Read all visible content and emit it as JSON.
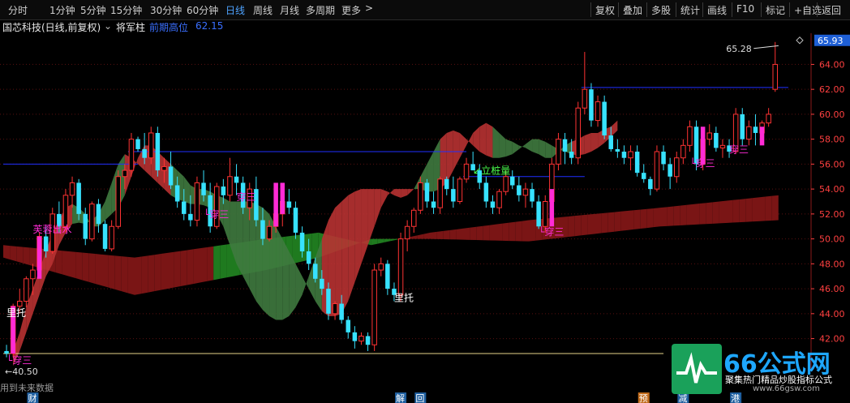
{
  "toolbar": {
    "periods": [
      "分时",
      "1分钟",
      "5分钟",
      "15分钟",
      "30分钟",
      "60分钟",
      "日线",
      "周线",
      "月线",
      "多周期",
      "更多"
    ],
    "active_period": "日线",
    "more_chevron": ">",
    "right_buttons": [
      "复权",
      "叠加",
      "多股",
      "统计",
      "画线",
      "F10",
      "标记",
      "+自选",
      "返回"
    ]
  },
  "info": {
    "stock": "国芯科技(日线,前复权)",
    "indicator": "将军柱",
    "label": "前期高位",
    "value": "62.15"
  },
  "colors": {
    "up": "#ff3333",
    "down": "#37e2ff",
    "magenta": "#ff2bd6",
    "band_red": "#b83232",
    "band_green": "#3f7a3f",
    "long_red": "#7a1515",
    "long_green": "#1f7a1f",
    "hline_blue": "#1f2fff",
    "axis_text": "#ff4040",
    "accent": "#4ea3ff"
  },
  "chart_data": {
    "type": "candlestick",
    "ylim": [
      39.5,
      66.5
    ],
    "y_ticks": [
      42.0,
      44.0,
      46.0,
      48.0,
      50.0,
      52.0,
      54.0,
      56.0,
      58.0,
      60.0,
      62.0,
      64.0
    ],
    "current_price": "65.93",
    "candles": [
      [
        41.0,
        41.5,
        40.5,
        40.8
      ],
      [
        40.8,
        44.8,
        40.5,
        44.6
      ],
      [
        44.6,
        46.0,
        44.0,
        45.0
      ],
      [
        45.0,
        47.0,
        44.5,
        46.8
      ],
      [
        46.8,
        48.0,
        45.5,
        47.5
      ],
      [
        47.5,
        50.5,
        47.0,
        50.2
      ],
      [
        50.2,
        51.0,
        48.5,
        49.0
      ],
      [
        49.0,
        52.5,
        48.8,
        52.0
      ],
      [
        52.0,
        53.0,
        50.5,
        51.0
      ],
      [
        51.0,
        54.0,
        50.5,
        53.5
      ],
      [
        53.5,
        55.0,
        52.5,
        54.5
      ],
      [
        54.5,
        54.8,
        51.5,
        52.0
      ],
      [
        52.0,
        52.5,
        49.5,
        50.0
      ],
      [
        50.0,
        53.0,
        49.8,
        52.8
      ],
      [
        52.8,
        53.2,
        50.5,
        51.2
      ],
      [
        51.2,
        51.5,
        49.0,
        49.2
      ],
      [
        49.2,
        51.5,
        49.0,
        51.0
      ],
      [
        51.0,
        55.5,
        50.8,
        55.0
      ],
      [
        55.0,
        56.0,
        54.0,
        55.5
      ],
      [
        55.5,
        58.5,
        55.0,
        58.0
      ],
      [
        58.0,
        58.2,
        57.0,
        57.2
      ],
      [
        57.2,
        58.5,
        56.0,
        56.5
      ],
      [
        56.5,
        59.0,
        56.0,
        58.5
      ],
      [
        58.5,
        59.0,
        55.0,
        55.5
      ],
      [
        55.5,
        56.5,
        54.5,
        55.8
      ],
      [
        55.8,
        57.0,
        54.0,
        54.3
      ],
      [
        54.3,
        55.0,
        52.5,
        53.0
      ],
      [
        53.0,
        54.0,
        51.5,
        52.0
      ],
      [
        52.0,
        53.5,
        51.0,
        51.5
      ],
      [
        51.5,
        55.0,
        51.0,
        54.5
      ],
      [
        54.5,
        55.5,
        53.0,
        53.5
      ],
      [
        53.5,
        54.5,
        50.5,
        51.0
      ],
      [
        51.0,
        54.5,
        50.8,
        54.2
      ],
      [
        54.2,
        54.8,
        52.8,
        53.5
      ],
      [
        53.5,
        56.5,
        53.0,
        55.0
      ],
      [
        55.0,
        56.0,
        53.5,
        54.5
      ],
      [
        54.5,
        55.0,
        52.0,
        52.5
      ],
      [
        52.5,
        54.5,
        51.5,
        54.0
      ],
      [
        54.0,
        55.0,
        51.0,
        51.5
      ],
      [
        51.5,
        52.5,
        49.5,
        50.0
      ],
      [
        50.0,
        51.5,
        49.8,
        51.0
      ],
      [
        51.0,
        52.5,
        50.5,
        52.0
      ],
      [
        52.0,
        53.5,
        51.0,
        53.0
      ],
      [
        53.0,
        54.0,
        52.0,
        52.5
      ],
      [
        52.5,
        53.0,
        50.0,
        50.5
      ],
      [
        50.5,
        51.0,
        48.5,
        49.0
      ],
      [
        49.0,
        50.0,
        47.5,
        48.0
      ],
      [
        48.0,
        48.5,
        46.5,
        46.8
      ],
      [
        46.8,
        47.5,
        45.5,
        46.0
      ],
      [
        46.0,
        46.5,
        43.5,
        44.0
      ],
      [
        44.0,
        45.0,
        43.5,
        44.8
      ],
      [
        44.8,
        45.5,
        43.2,
        43.5
      ],
      [
        43.5,
        43.8,
        42.0,
        42.5
      ],
      [
        42.5,
        43.0,
        41.2,
        41.8
      ],
      [
        41.8,
        42.5,
        41.5,
        42.2
      ],
      [
        42.2,
        42.5,
        41.0,
        41.5
      ],
      [
        41.5,
        48.0,
        41.0,
        47.5
      ],
      [
        47.5,
        48.5,
        47.0,
        48.0
      ],
      [
        48.0,
        48.3,
        45.5,
        46.0
      ],
      [
        46.0,
        46.5,
        45.0,
        45.5
      ],
      [
        45.5,
        50.5,
        45.0,
        50.0
      ],
      [
        50.0,
        51.5,
        49.0,
        51.0
      ],
      [
        51.0,
        52.5,
        50.5,
        52.3
      ],
      [
        52.3,
        55.0,
        52.0,
        54.5
      ],
      [
        54.5,
        54.8,
        52.5,
        53.0
      ],
      [
        53.0,
        53.8,
        52.0,
        52.5
      ],
      [
        52.5,
        55.0,
        52.0,
        54.8
      ],
      [
        54.8,
        55.0,
        53.5,
        54.0
      ],
      [
        54.0,
        55.0,
        52.5,
        53.0
      ],
      [
        53.0,
        55.0,
        52.8,
        54.8
      ],
      [
        54.8,
        56.5,
        54.5,
        56.0
      ],
      [
        56.0,
        57.0,
        55.5,
        55.5
      ],
      [
        55.5,
        56.0,
        54.0,
        54.5
      ],
      [
        54.5,
        55.0,
        52.5,
        53.0
      ],
      [
        53.0,
        53.5,
        52.0,
        52.5
      ],
      [
        52.5,
        54.0,
        52.0,
        53.8
      ],
      [
        53.8,
        55.5,
        53.5,
        55.0
      ],
      [
        55.0,
        55.5,
        54.0,
        54.3
      ],
      [
        54.3,
        55.0,
        53.0,
        53.5
      ],
      [
        53.5,
        54.5,
        52.5,
        54.0
      ],
      [
        54.0,
        54.5,
        52.5,
        53.0
      ],
      [
        53.0,
        53.5,
        50.8,
        51.0
      ],
      [
        51.0,
        53.5,
        50.5,
        53.0
      ],
      [
        53.0,
        56.5,
        52.5,
        56.0
      ],
      [
        56.0,
        58.5,
        55.5,
        58.0
      ],
      [
        58.0,
        58.5,
        56.0,
        57.0
      ],
      [
        57.0,
        58.0,
        56.0,
        56.5
      ],
      [
        56.5,
        61.0,
        56.0,
        60.5
      ],
      [
        60.5,
        65.0,
        60.0,
        62.0
      ],
      [
        62.0,
        62.5,
        59.0,
        59.5
      ],
      [
        59.5,
        61.5,
        59.0,
        61.0
      ],
      [
        61.0,
        61.5,
        58.0,
        58.3
      ],
      [
        58.3,
        59.0,
        57.0,
        57.2
      ],
      [
        57.2,
        58.0,
        56.5,
        57.0
      ],
      [
        57.0,
        57.5,
        56.0,
        56.5
      ],
      [
        56.5,
        57.5,
        55.5,
        57.0
      ],
      [
        57.0,
        57.5,
        55.0,
        55.3
      ],
      [
        55.3,
        56.0,
        54.5,
        54.8
      ],
      [
        54.8,
        55.0,
        53.5,
        54.0
      ],
      [
        54.0,
        57.5,
        53.8,
        57.0
      ],
      [
        57.0,
        57.5,
        55.5,
        56.0
      ],
      [
        56.0,
        56.5,
        54.0,
        55.0
      ],
      [
        55.0,
        57.0,
        54.5,
        56.5
      ],
      [
        56.5,
        58.0,
        56.0,
        57.5
      ],
      [
        57.5,
        59.5,
        57.0,
        59.0
      ],
      [
        59.0,
        59.5,
        55.5,
        56.0
      ],
      [
        56.0,
        58.5,
        55.5,
        58.0
      ],
      [
        58.0,
        59.2,
        57.5,
        58.5
      ],
      [
        58.5,
        59.0,
        57.0,
        57.3
      ],
      [
        57.3,
        58.0,
        56.5,
        57.5
      ],
      [
        57.5,
        58.0,
        56.5,
        57.0
      ],
      [
        57.0,
        60.5,
        56.8,
        60.0
      ],
      [
        60.0,
        60.5,
        57.5,
        58.0
      ],
      [
        58.0,
        59.5,
        57.5,
        59.0
      ],
      [
        59.0,
        60.0,
        57.5,
        58.5
      ],
      [
        58.5,
        59.5,
        58.0,
        59.3
      ],
      [
        59.3,
        60.5,
        59.0,
        60.0
      ],
      [
        62.0,
        65.8,
        61.8,
        64.0
      ]
    ],
    "magenta_bars": [
      [
        1,
        40.8,
        44.6
      ],
      [
        5,
        46.8,
        50.2
      ],
      [
        41,
        51.0,
        54.5
      ],
      [
        42,
        52.0,
        54.5
      ],
      [
        83,
        51.0,
        54.0
      ],
      [
        106,
        56.0,
        59.0
      ],
      [
        115,
        57.5,
        59.0
      ]
    ],
    "band": {
      "start": 1,
      "upper": [
        41.0,
        42.5,
        44.5,
        46.0,
        47.5,
        49.0,
        50.5,
        51.5,
        52.5,
        52.8,
        52.5,
        52.0,
        51.0,
        51.0,
        51.5,
        52.0,
        52.5,
        53.5,
        55.0,
        56.5,
        57.5,
        57.5,
        57.0,
        56.5,
        56.0,
        55.5,
        55.0,
        54.3,
        54.0,
        54.0,
        53.8,
        53.5,
        53.3,
        53.0,
        53.0,
        53.0,
        53.0,
        52.8,
        52.5,
        52.0,
        51.0,
        50.0,
        49.0,
        48.0,
        47.0,
        46.0,
        45.0,
        44.2,
        43.8,
        43.8,
        44.0,
        45.0,
        46.5,
        48.0,
        49.5,
        51.0,
        52.5,
        53.5,
        54.0,
        54.0,
        54.0,
        54.0,
        54.0,
        53.8,
        53.8,
        54.0,
        54.5,
        55.5,
        56.5,
        57.5,
        58.5,
        59.0,
        59.3,
        59.0,
        58.5,
        58.0,
        57.8,
        57.5,
        57.3,
        57.0,
        56.8,
        56.5,
        56.5,
        57.0,
        57.5,
        57.8,
        58.0,
        58.3,
        58.5,
        58.5,
        58.8,
        59.0,
        59.5
      ],
      "lower": [
        39.8,
        41.0,
        42.5,
        44.0,
        45.5,
        47.0,
        48.0,
        49.5,
        50.5,
        51.2,
        51.3,
        51.2,
        51.5,
        52.0,
        53.0,
        54.5,
        56.0,
        56.8,
        56.5,
        56.0,
        55.5,
        55.0,
        54.5,
        54.0,
        53.5,
        53.2,
        53.0,
        52.8,
        52.8,
        52.7,
        52.5,
        52.0,
        51.0,
        49.5,
        48.0,
        47.0,
        46.0,
        45.0,
        44.3,
        43.8,
        43.5,
        43.5,
        43.8,
        44.5,
        45.5,
        47.0,
        48.5,
        50.0,
        51.5,
        52.5,
        53.0,
        53.5,
        53.8,
        54.0,
        54.0,
        54.0,
        54.0,
        53.8,
        53.5,
        53.3,
        53.5,
        54.0,
        55.0,
        56.0,
        57.0,
        58.0,
        58.5,
        58.7,
        58.5,
        58.0,
        57.5,
        57.0,
        56.7,
        56.5,
        56.5,
        56.6,
        56.8,
        57.2,
        57.6,
        58.0,
        58.0,
        57.8,
        57.5,
        57.2,
        57.0,
        56.8,
        56.7,
        56.8,
        57.0,
        57.3,
        57.7,
        58.2,
        58.7
      ]
    },
    "band_colors": [
      "r",
      "r",
      "r",
      "r",
      "r",
      "r",
      "r",
      "r",
      "r",
      "g",
      "g",
      "g",
      "g",
      "g",
      "g",
      "g",
      "g",
      "r",
      "r",
      "r",
      "r",
      "r",
      "r",
      "r",
      "g",
      "g",
      "g",
      "g",
      "g",
      "g",
      "g",
      "g",
      "g",
      "g",
      "g",
      "g",
      "g",
      "g",
      "g",
      "g",
      "g",
      "g",
      "g",
      "g",
      "g",
      "g",
      "g",
      "r",
      "r",
      "r",
      "r",
      "r",
      "r",
      "r",
      "r",
      "r",
      "r",
      "r",
      "r",
      "r",
      "r",
      "g",
      "g",
      "g",
      "g",
      "r",
      "r",
      "r",
      "r",
      "r",
      "r",
      "r",
      "r",
      "g",
      "g",
      "g",
      "g",
      "g",
      "g",
      "g",
      "g",
      "g",
      "g",
      "g",
      "g",
      "r",
      "r",
      "r",
      "r",
      "r",
      "r",
      "r",
      "r"
    ],
    "long_band": {
      "upper": [
        [
          0,
          49.5
        ],
        [
          20,
          48.5
        ],
        [
          40,
          50.0
        ],
        [
          48,
          50.5
        ],
        [
          56,
          49.5
        ],
        [
          65,
          50.5
        ],
        [
          80,
          51.5
        ],
        [
          100,
          52.5
        ],
        [
          118,
          53.5
        ]
      ],
      "lower": [
        [
          0,
          48.5
        ],
        [
          20,
          45.5
        ],
        [
          40,
          47.5
        ],
        [
          48,
          48.5
        ],
        [
          56,
          50.0
        ],
        [
          65,
          50.0
        ],
        [
          80,
          49.8
        ],
        [
          100,
          51.0
        ],
        [
          118,
          51.5
        ]
      ],
      "green_range": [
        32,
        60
      ]
    },
    "hlines": [
      {
        "price": 56.0,
        "from": 0,
        "to": 20,
        "color": "blue"
      },
      {
        "price": 57.0,
        "from": 19,
        "to": 70,
        "color": "blue"
      },
      {
        "price": 55.0,
        "from": 70,
        "to": 88,
        "color": "blue"
      },
      {
        "price": 62.15,
        "from": 88,
        "to": 119,
        "color": "blue"
      },
      {
        "price": 40.8,
        "from": 0,
        "to": 100,
        "color": "yellow"
      }
    ],
    "annotations": [
      {
        "i": 0,
        "price": 43.8,
        "text": "里托",
        "color": "white"
      },
      {
        "i": 0,
        "price": 40.0,
        "text": "└穿三",
        "color": "magenta"
      },
      {
        "i": 4,
        "price": 50.5,
        "text": "芙蓉出水",
        "color": "magenta"
      },
      {
        "i": 30,
        "price": 51.7,
        "text": "└穿三",
        "color": "magenta"
      },
      {
        "i": 35,
        "price": 53.1,
        "text": "穿三",
        "color": "magenta"
      },
      {
        "i": 59,
        "price": 45.0,
        "text": "里托",
        "color": "white"
      },
      {
        "i": 71,
        "price": 55.2,
        "text": "↙立桩量",
        "color": "green"
      },
      {
        "i": 81,
        "price": 50.3,
        "text": "└穿三",
        "color": "magenta"
      },
      {
        "i": 104,
        "price": 55.8,
        "text": "└穿三",
        "color": "magenta"
      },
      {
        "i": 110,
        "price": 56.9,
        "text": "穿三",
        "color": "magenta"
      }
    ],
    "high_label": "65.28",
    "low_label": "←40.50",
    "future_text": "用到未来数据",
    "bottom_markers": [
      {
        "i": 4,
        "text": "财",
        "bg": "#1f5f9f"
      },
      {
        "i": 60,
        "text": "解",
        "bg": "#1f5f9f"
      },
      {
        "i": 63,
        "text": "回",
        "bg": "#1f5f9f"
      },
      {
        "i": 97,
        "text": "预",
        "bg": "#c06a1a"
      },
      {
        "i": 103,
        "text": "减",
        "bg": "#1f5f9f"
      },
      {
        "i": 111,
        "text": "港",
        "bg": "#1f5f9f"
      }
    ]
  },
  "watermark": {
    "title": "66公式网",
    "subtitle": "聚集热门精品炒股指标公式",
    "url": "www.66gsw.com"
  }
}
